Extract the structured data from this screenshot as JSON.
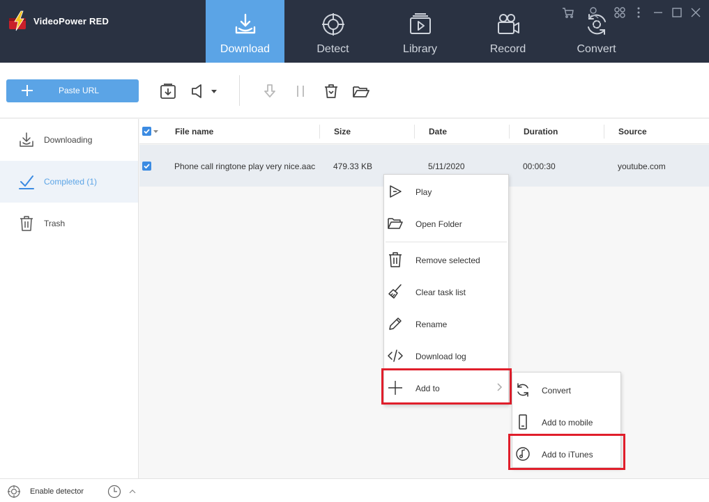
{
  "app": {
    "title": "VideoPower RED"
  },
  "nav": {
    "tabs": [
      {
        "label": "Download",
        "icon": "download-tray-icon",
        "active": true
      },
      {
        "label": "Detect",
        "icon": "target-icon",
        "active": false
      },
      {
        "label": "Library",
        "icon": "library-play-icon",
        "active": false
      },
      {
        "label": "Record",
        "icon": "video-camera-icon",
        "active": false
      },
      {
        "label": "Convert",
        "icon": "convert-cycle-icon",
        "active": false
      }
    ]
  },
  "toolbar": {
    "paste_url_label": "Paste URL"
  },
  "sidebar": {
    "items": [
      {
        "label": "Downloading",
        "icon": "download-icon"
      },
      {
        "label": "Completed (1)",
        "icon": "check-icon",
        "active": true
      },
      {
        "label": "Trash",
        "icon": "trash-icon"
      }
    ]
  },
  "table": {
    "columns": [
      "File name",
      "Size",
      "Date",
      "Duration",
      "Source"
    ],
    "rows": [
      {
        "file_name": "Phone call ringtone play very nice.aac",
        "size": "479.33 KB",
        "date": "5/11/2020",
        "duration": "00:00:30",
        "source": "youtube.com",
        "checked": true
      }
    ]
  },
  "context_menu": {
    "items": [
      {
        "label": "Play",
        "icon": "play-icon"
      },
      {
        "label": "Open Folder",
        "icon": "folder-open-icon"
      },
      {
        "label": "Remove selected",
        "icon": "trash-icon"
      },
      {
        "label": "Clear task list",
        "icon": "broom-icon"
      },
      {
        "label": "Rename",
        "icon": "pencil-icon"
      },
      {
        "label": "Download log",
        "icon": "code-icon"
      },
      {
        "label": "Add to",
        "icon": "plus-icon",
        "has_submenu": true
      }
    ],
    "submenu": {
      "items": [
        {
          "label": "Convert",
          "icon": "refresh-icon"
        },
        {
          "label": "Add to mobile",
          "icon": "mobile-icon"
        },
        {
          "label": "Add to iTunes",
          "icon": "music-note-icon"
        }
      ]
    }
  },
  "statusbar": {
    "enable_detector_label": "Enable detector"
  },
  "colors": {
    "accent": "#5ba4e6",
    "header_bg": "#2a3242",
    "highlight": "#e01e2b",
    "checkbox": "#3b8be2"
  }
}
